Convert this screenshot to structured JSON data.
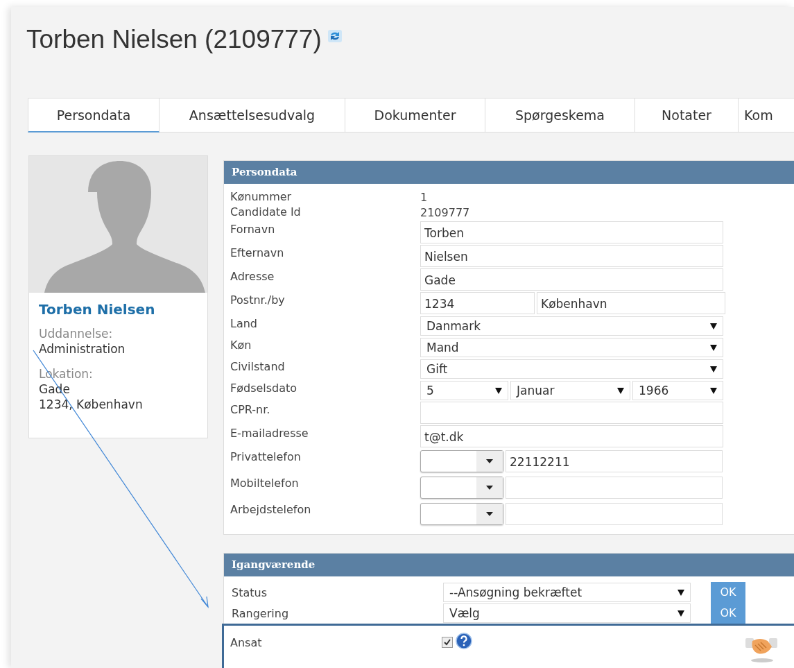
{
  "title": "Torben Nielsen (2109777)",
  "tabs": [
    {
      "label": "Persondata",
      "selected": true
    },
    {
      "label": "Ansættelsesudvalg",
      "selected": false
    },
    {
      "label": "Dokumenter",
      "selected": false
    },
    {
      "label": "Spørgeskema",
      "selected": false
    },
    {
      "label": "Notater",
      "selected": false
    },
    {
      "label": "Kom",
      "selected": false
    }
  ],
  "profile": {
    "name": "Torben Nielsen",
    "fields": [
      {
        "label": "Uddannelse:",
        "lines": [
          "Administration"
        ]
      },
      {
        "label": "Lokation:",
        "lines": [
          "Gade",
          "1234, København"
        ]
      }
    ]
  },
  "persondata": {
    "title": "Persondata",
    "rows": [
      {
        "label": "Kønummer",
        "kind": "text",
        "value": "1"
      },
      {
        "label": "Candidate Id",
        "kind": "text",
        "value": "2109777"
      },
      {
        "label": "Fornavn",
        "kind": "input",
        "value": "Torben"
      },
      {
        "label": "Efternavn",
        "kind": "input",
        "value": "Nielsen"
      },
      {
        "label": "Adresse",
        "kind": "input",
        "value": "Gade"
      },
      {
        "label": "Postnr./by",
        "kind": "pair",
        "values": [
          "1234",
          "København"
        ]
      },
      {
        "label": "Land",
        "kind": "select",
        "value": "Danmark"
      },
      {
        "label": "Køn",
        "kind": "select",
        "value": "Mand"
      },
      {
        "label": "Civilstand",
        "kind": "select",
        "value": "Gift"
      },
      {
        "label": "Fødselsdato",
        "kind": "date",
        "values": [
          "5",
          "Januar",
          "1966"
        ]
      },
      {
        "label": "CPR-nr.",
        "kind": "input"
      },
      {
        "label": "E-mailadresse",
        "kind": "input",
        "value": "t@t.dk"
      },
      {
        "label": "Privattelefon",
        "kind": "phone",
        "value": "22112211"
      },
      {
        "label": "Mobiltelefon",
        "kind": "phone"
      },
      {
        "label": "Arbejdstelefon",
        "kind": "phone"
      }
    ]
  },
  "igangvaerende": {
    "title": "Igangværende",
    "rows": [
      {
        "label": "Status",
        "value": "--Ansøgning bekræftet",
        "button": "OK"
      },
      {
        "label": "Rangering",
        "value": "Vælg",
        "button": "OK"
      }
    ],
    "ansat": {
      "label": "Ansat",
      "checked": true
    }
  }
}
